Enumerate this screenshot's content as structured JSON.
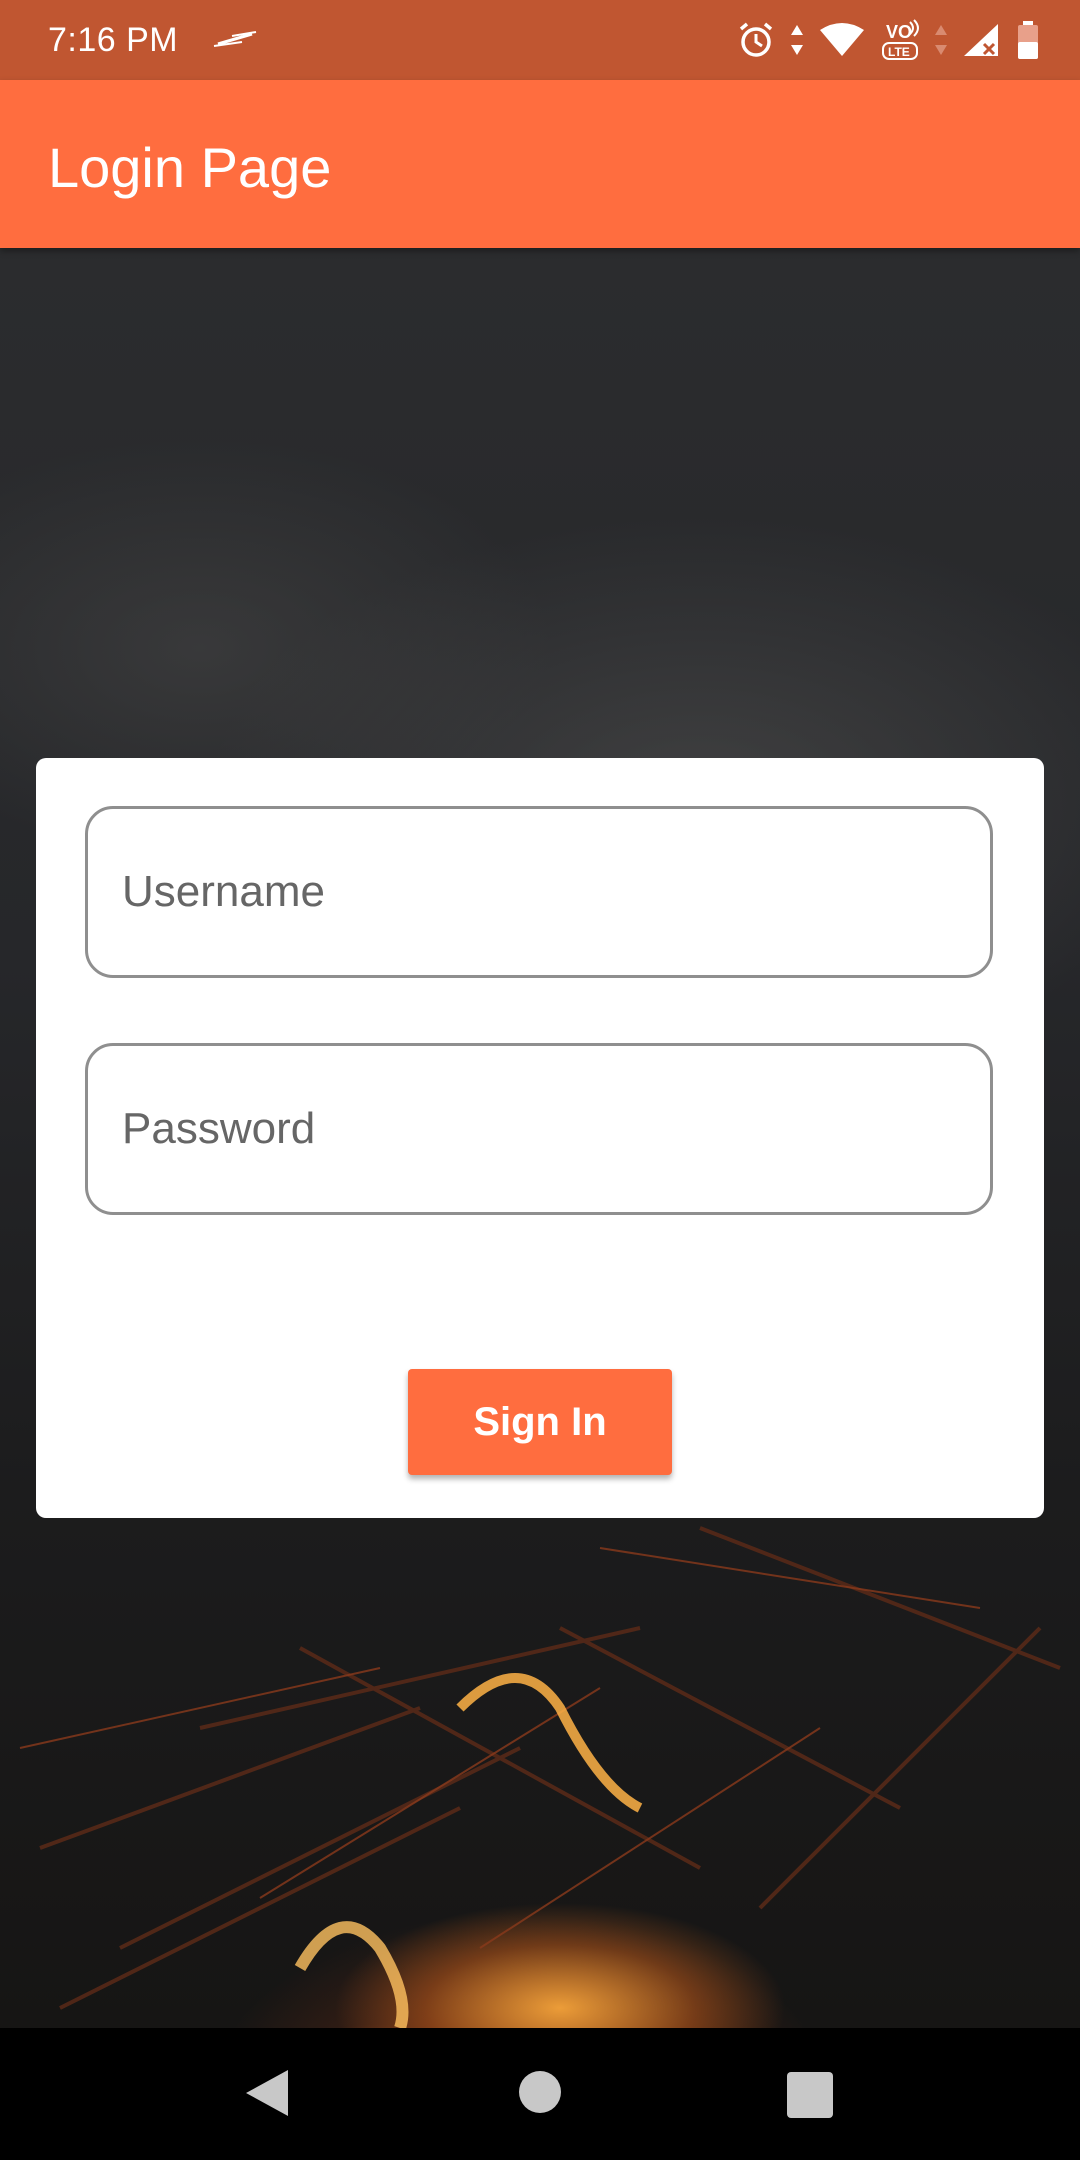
{
  "status_bar": {
    "time": "7:16 PM",
    "left_icon": "signal-app-icon",
    "icons": [
      "alarm-icon",
      "data-arrows-icon",
      "wifi-icon",
      "volte-icon",
      "data-arrows-icon",
      "cell-signal-icon",
      "battery-icon"
    ],
    "volte_label": "VO",
    "lte_label": "LTE"
  },
  "app_bar": {
    "title": "Login Page",
    "color": "#ff6d3f"
  },
  "login_form": {
    "username_placeholder": "Username",
    "username_value": "",
    "password_placeholder": "Password",
    "password_value": "",
    "signin_label": "Sign In",
    "button_color": "#ff6d3f"
  },
  "nav_bar": {
    "icons": [
      "back-icon",
      "home-icon",
      "recents-icon"
    ]
  },
  "colors": {
    "status_bar": "#c05631",
    "card": "#ffffff",
    "field_border": "#8f8f8f"
  }
}
